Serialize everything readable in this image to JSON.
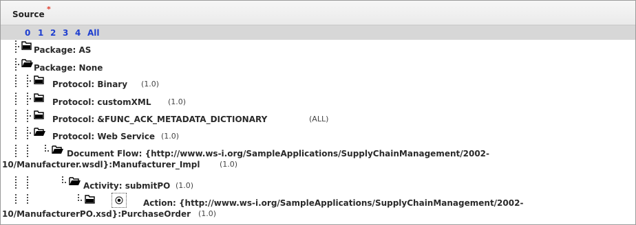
{
  "section": {
    "title": "Source",
    "required_mark": "*"
  },
  "levels": [
    "0",
    "1",
    "2",
    "3",
    "4",
    "All"
  ],
  "tree": {
    "package_as": {
      "label": "Package: AS",
      "icon": "folder-closed-icon"
    },
    "package_none": {
      "label": "Package: None",
      "icon": "folder-open-icon"
    },
    "protocol_binary": {
      "label": "Protocol: Binary",
      "version": "(1.0)",
      "icon": "folder-closed-icon"
    },
    "protocol_customxml": {
      "label": "Protocol: customXML",
      "version": "(1.0)",
      "icon": "folder-closed-icon"
    },
    "protocol_func": {
      "label": "Protocol: &FUNC_ACK_METADATA_DICTIONARY",
      "version": "(ALL)",
      "icon": "folder-closed-icon"
    },
    "protocol_ws": {
      "label": "Protocol: Web Service",
      "version": "(1.0)",
      "icon": "folder-open-icon"
    },
    "document_flow": {
      "line1": "Document Flow: {http://www.ws-i.org/SampleApplications/SupplyChainManagement/2002-",
      "line2": "10/Manufacturer.wsdl}:Manufacturer_Impl",
      "version": "(1.0)",
      "icon": "folder-open-icon"
    },
    "activity": {
      "label": "Activity: submitPO",
      "version": "(1.0)",
      "icon": "folder-open-icon"
    },
    "action": {
      "line1": "Action: {http://www.ws-i.org/SampleApplications/SupplyChainManagement/2002-",
      "line2": "10/ManufacturerPO.xsd}:PurchaseOrder",
      "version": "(1.0)",
      "icon": "folder-closed-icon",
      "selected": true
    }
  },
  "colors": {
    "link": "#1f3fd0",
    "required": "#e03a2a",
    "level_bar": "#d7d7d7"
  }
}
